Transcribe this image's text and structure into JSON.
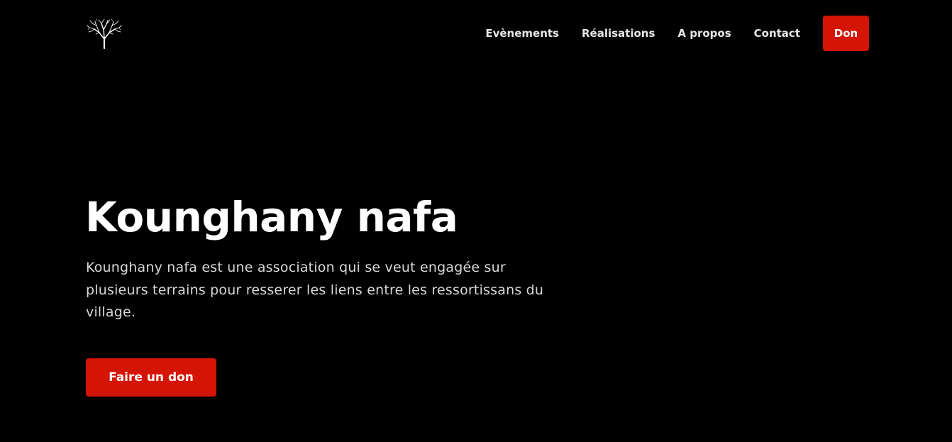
{
  "header": {
    "logo_icon": "tree-icon",
    "nav": [
      {
        "label": "Evènements"
      },
      {
        "label": "Réalisations"
      },
      {
        "label": "A propos"
      },
      {
        "label": "Contact"
      }
    ],
    "donate_label": "Don"
  },
  "hero": {
    "title": "Kounghany nafa",
    "description": "Kounghany nafa est une association qui se veut engagée sur plusieurs terrains pour resserer les liens entre les ressortissans du village.",
    "cta_label": "Faire un don"
  },
  "colors": {
    "background": "#000000",
    "accent": "#d41405",
    "text": "#ffffff"
  }
}
